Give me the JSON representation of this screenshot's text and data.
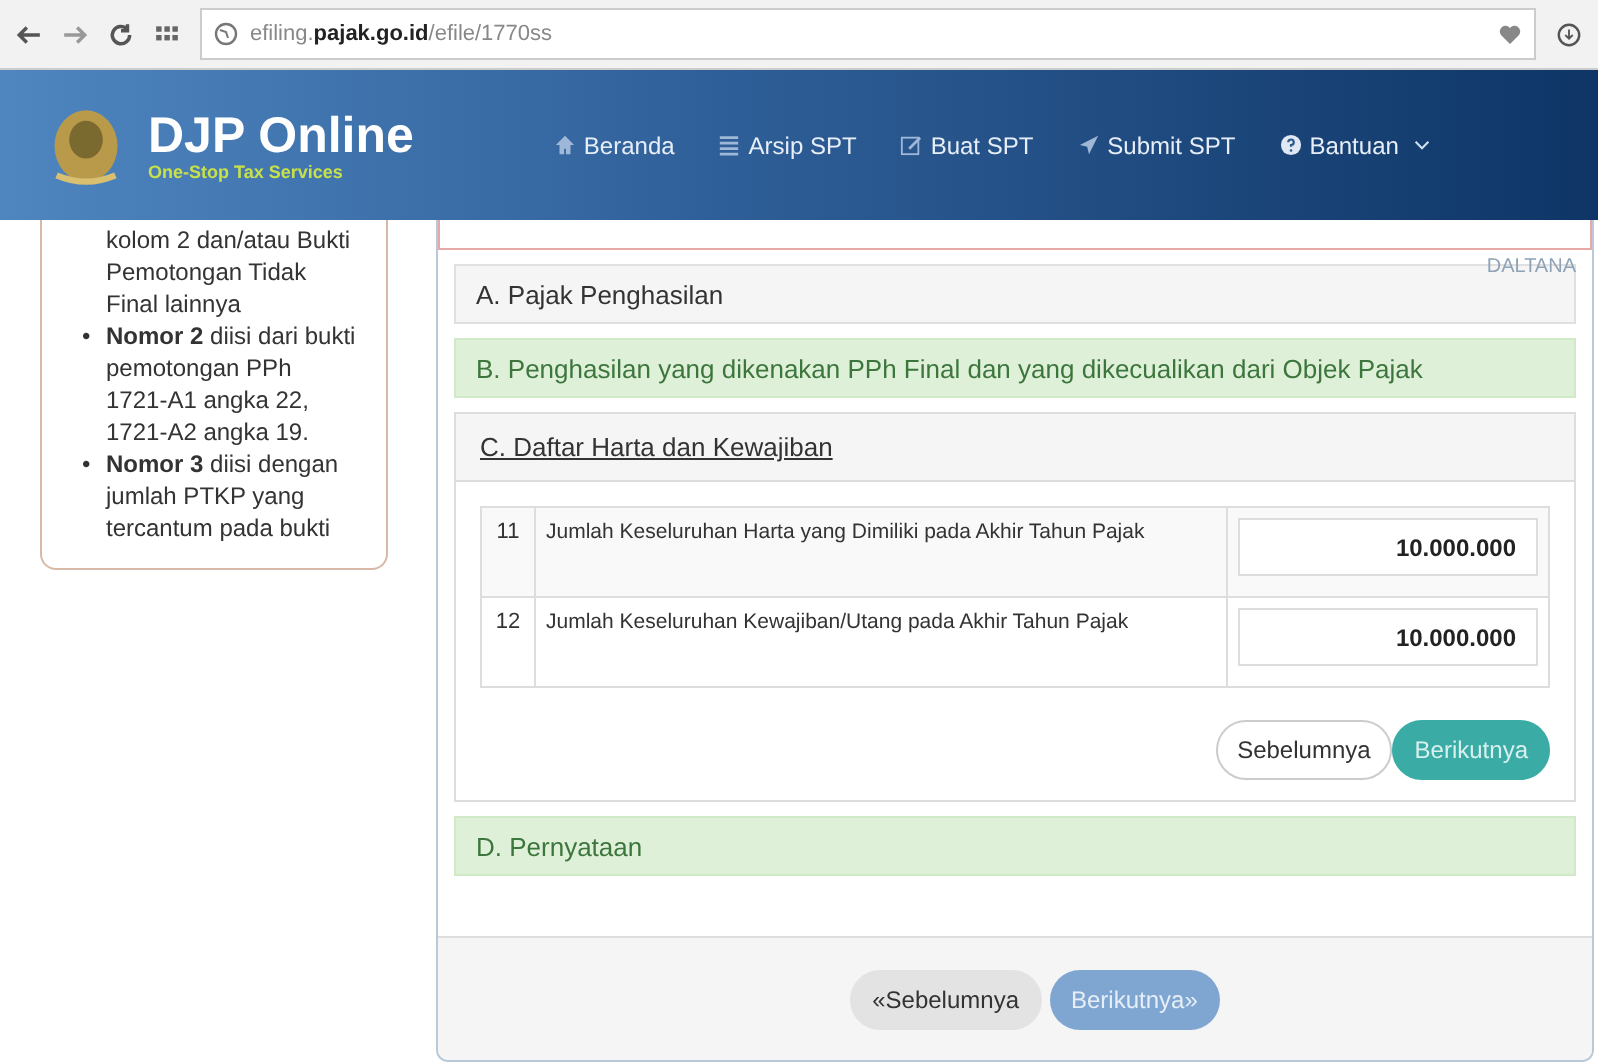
{
  "browser": {
    "url_host_prefix": "efiling.",
    "url_host": "pajak.go.id",
    "url_path": "/efile/1770ss"
  },
  "header": {
    "brand": "DJP Online",
    "tagline": "One-Stop Tax Services",
    "nav": [
      {
        "label": "Beranda",
        "dropdown": false
      },
      {
        "label": "Arsip SPT",
        "dropdown": false
      },
      {
        "label": "Buat SPT",
        "dropdown": false
      },
      {
        "label": "Submit SPT",
        "dropdown": false
      },
      {
        "label": "Bantuan",
        "dropdown": true
      }
    ]
  },
  "sidebar": {
    "items": [
      {
        "text": "kolom 2 dan/atau Bukti Pemotongan Tidak Final lainnya"
      },
      {
        "marker": "•",
        "text": "**Nomor 2** diisi dari bukti pemotongan PPh 1721-A1 angka 22, 1721-A2 angka 19."
      },
      {
        "marker": "•",
        "text": "**Nomor 3** diisi dengan jumlah PTKP yang tercantum pada bukti"
      }
    ]
  },
  "user": {
    "name": "DALTANA"
  },
  "sections": [
    {
      "title": "A. Pajak Penghasilan",
      "kind": "default",
      "expanded": false
    },
    {
      "title": "B. Penghasilan yang dikenakan PPh Final dan yang dikecualikan dari Objek Pajak",
      "kind": "success",
      "expanded": false
    },
    {
      "title": "C. Daftar Harta dan Kewajiban",
      "kind": "default",
      "expanded": true,
      "rows": [
        {
          "no": "11",
          "label": "Jumlah Keseluruhan Harta yang Dimiliki pada Akhir Tahun Pajak",
          "value": "10.000.000"
        },
        {
          "no": "12",
          "label": "Jumlah Keseluruhan Kewajiban/Utang pada Akhir Tahun Pajak",
          "value": "10.000.000"
        }
      ],
      "buttons": [
        {
          "label": "Sebelumnya",
          "kind": "default"
        },
        {
          "label": "Berikutnya",
          "kind": "primary"
        }
      ]
    },
    {
      "title": "D. Pernyataan",
      "kind": "success",
      "expanded": false
    }
  ],
  "footer_buttons": [
    {
      "label": "Sebelumnya",
      "kind": "prev",
      "arrow": "«"
    },
    {
      "label": "Berikutnya",
      "kind": "next",
      "arrow": "»"
    }
  ]
}
